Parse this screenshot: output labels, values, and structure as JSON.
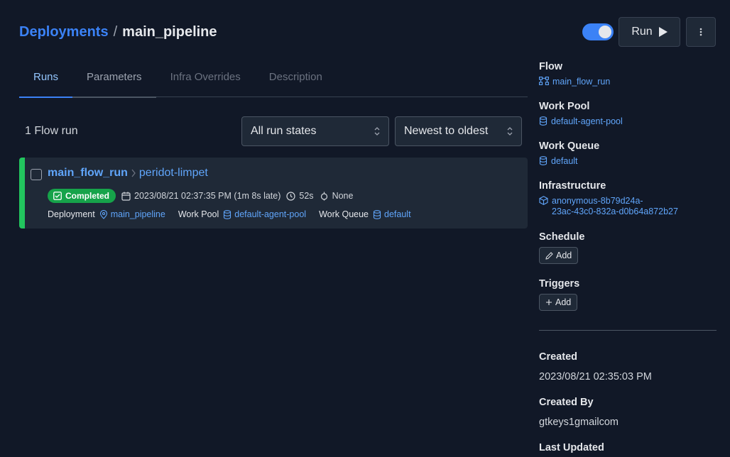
{
  "breadcrumb": {
    "root": "Deployments",
    "separator": "/",
    "current": "main_pipeline"
  },
  "actions": {
    "run_label": "Run",
    "toggle_on": true
  },
  "tabs": [
    {
      "label": "Runs",
      "state": "active"
    },
    {
      "label": "Parameters",
      "state": "hover"
    },
    {
      "label": "Infra Overrides",
      "state": "normal"
    },
    {
      "label": "Description",
      "state": "normal"
    }
  ],
  "toolbar": {
    "count": "1 Flow run",
    "state_filter": "All run states",
    "sort": "Newest to oldest"
  },
  "flow_run": {
    "flow_name": "main_flow_run",
    "run_name": "peridot-limpet",
    "status": "Completed",
    "start_time": "2023/08/21 02:37:35 PM (1m 8s late)",
    "duration": "52s",
    "tags": "None",
    "deployment_label": "Deployment",
    "deployment": "main_pipeline",
    "work_pool_label": "Work Pool",
    "work_pool": "default-agent-pool",
    "work_queue_label": "Work Queue",
    "work_queue": "default"
  },
  "sidebar": {
    "flow_label": "Flow",
    "flow": "main_flow_run",
    "work_pool_label": "Work Pool",
    "work_pool": "default-agent-pool",
    "work_queue_label": "Work Queue",
    "work_queue": "default",
    "infrastructure_label": "Infrastructure",
    "infrastructure_line1": "anonymous-8b79d24a-",
    "infrastructure_line2": "23ac-43c0-832a-d0b64a872b27",
    "schedule_label": "Schedule",
    "schedule_add": "Add",
    "triggers_label": "Triggers",
    "triggers_add": "Add",
    "created_label": "Created",
    "created": "2023/08/21 02:35:03 PM",
    "created_by_label": "Created By",
    "created_by": "gtkeys1gmailcom",
    "last_updated_label": "Last Updated"
  },
  "colors": {
    "accent": "#3b82f6",
    "completed": "#22c55e",
    "background": "#111827",
    "card": "#1f2937"
  }
}
